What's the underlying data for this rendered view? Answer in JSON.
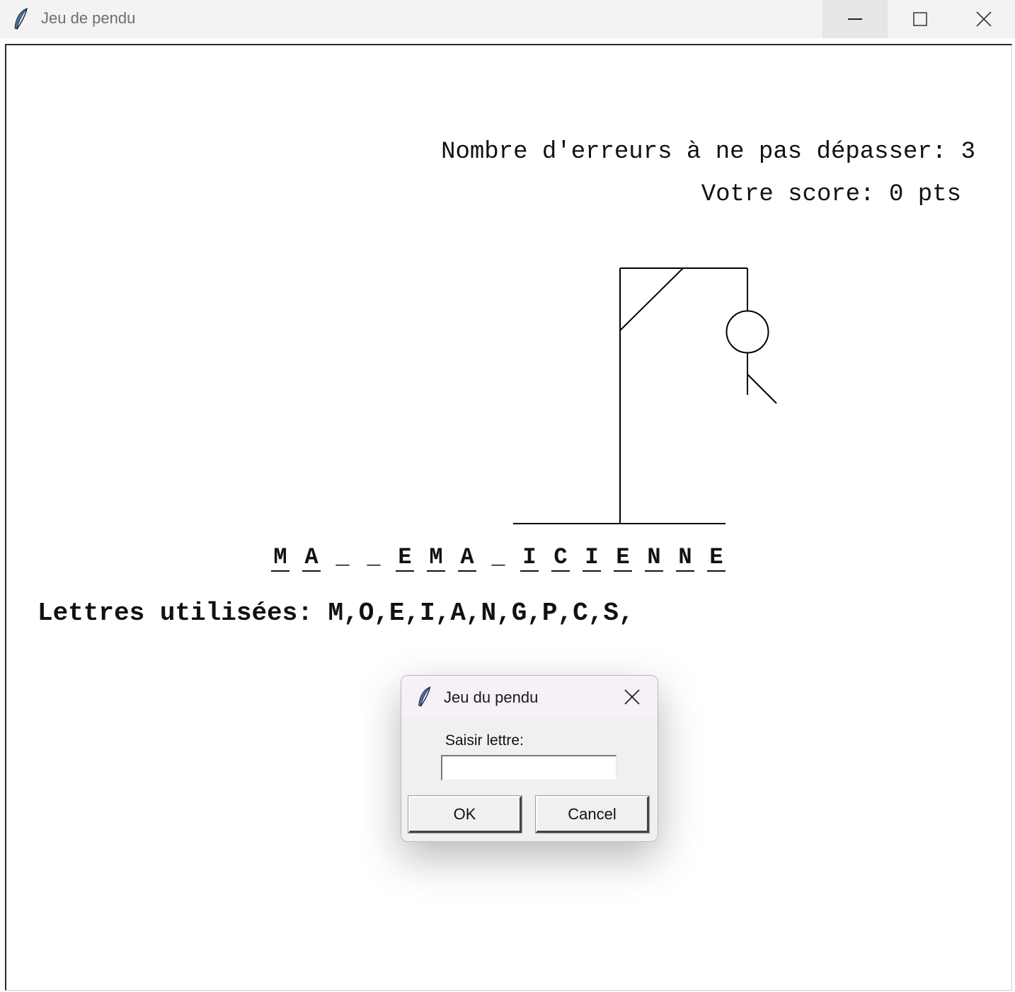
{
  "window": {
    "title": "Jeu de pendu"
  },
  "game": {
    "max_errors_text": "Nombre d'erreurs à ne pas dépasser: 3",
    "score_text": "Votre score: 0 pts",
    "word_slots": [
      {
        "letter": "M"
      },
      {
        "letter": "A"
      },
      {
        "letter": "_"
      },
      {
        "letter": "_"
      },
      {
        "letter": "E"
      },
      {
        "letter": "M"
      },
      {
        "letter": "A"
      },
      {
        "letter": "_"
      },
      {
        "letter": "I"
      },
      {
        "letter": "C"
      },
      {
        "letter": "I"
      },
      {
        "letter": "E"
      },
      {
        "letter": "N"
      },
      {
        "letter": "N"
      },
      {
        "letter": "E"
      }
    ],
    "used_letters_label": "Lettres utilisées:",
    "used_letters": "M,O,E,I,A,N,G,P,C,S,"
  },
  "dialog": {
    "title": "Jeu du pendu",
    "prompt": "Saisir lettre:",
    "input_value": "",
    "ok_label": "OK",
    "cancel_label": "Cancel"
  },
  "colors": {
    "background": "#ffffff",
    "text": "#111111",
    "titlebar": "#f3f3f3"
  }
}
